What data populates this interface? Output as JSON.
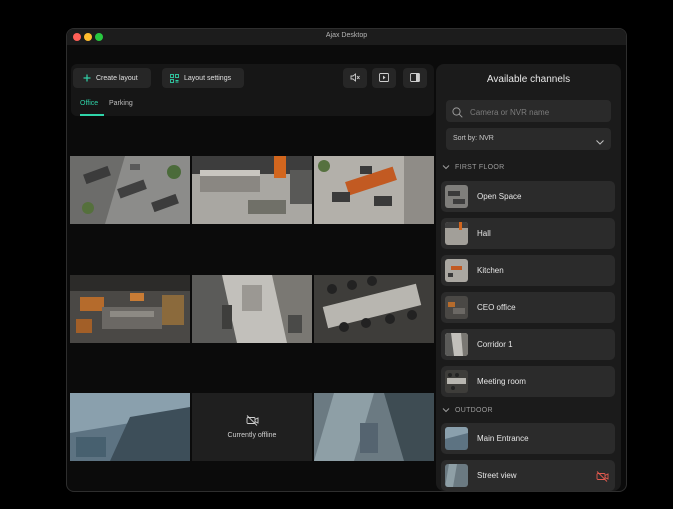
{
  "window": {
    "title": "Ajax Desktop"
  },
  "toolbar": {
    "create_layout_label": "Create layout",
    "layout_settings_label": "Layout settings"
  },
  "tabs": [
    {
      "label": "Office",
      "active": true
    },
    {
      "label": "Parking",
      "active": false
    }
  ],
  "grid": {
    "offline_label": "Currently offline"
  },
  "channels_panel": {
    "title": "Available channels",
    "search_placeholder": "Camera or NVR name",
    "sort_label": "Sort by: NVR",
    "sections": [
      {
        "label": "FIRST FLOOR",
        "items": [
          {
            "label": "Open Space",
            "offline": false
          },
          {
            "label": "Hall",
            "offline": false
          },
          {
            "label": "Kitchen",
            "offline": false
          },
          {
            "label": "CEO office",
            "offline": false
          },
          {
            "label": "Corridor 1",
            "offline": false
          },
          {
            "label": "Meeting room",
            "offline": false
          }
        ]
      },
      {
        "label": "OUTDOOR",
        "items": [
          {
            "label": "Main Entrance",
            "offline": false
          },
          {
            "label": "Street view",
            "offline": true
          }
        ]
      }
    ]
  },
  "colors": {
    "accent": "#2fd4a9",
    "offline": "#e35a4f",
    "background": "#0b0b0b",
    "panel": "#1b1b1b"
  }
}
